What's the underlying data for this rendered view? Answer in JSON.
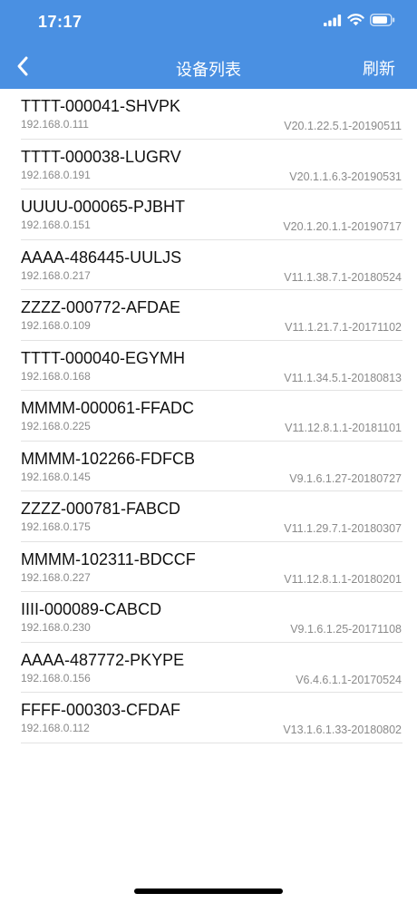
{
  "status_bar": {
    "time": "17:17",
    "icons": [
      "cellular-signal-icon",
      "wifi-icon",
      "battery-icon"
    ]
  },
  "nav": {
    "back_icon": "chevron-left-icon",
    "title": "设备列表",
    "refresh_label": "刷新"
  },
  "colors": {
    "header": "#4a90e2",
    "primary_text": "#111111",
    "secondary_text": "#8a8a8a",
    "divider": "#e2e2e2"
  },
  "devices": [
    {
      "name": "TTTT-000041-SHVPK",
      "ip": "192.168.0.111",
      "version": "V20.1.22.5.1-20190511"
    },
    {
      "name": "TTTT-000038-LUGRV",
      "ip": "192.168.0.191",
      "version": "V20.1.1.6.3-20190531"
    },
    {
      "name": "UUUU-000065-PJBHT",
      "ip": "192.168.0.151",
      "version": "V20.1.20.1.1-20190717"
    },
    {
      "name": "AAAA-486445-UULJS",
      "ip": "192.168.0.217",
      "version": "V11.1.38.7.1-20180524"
    },
    {
      "name": "ZZZZ-000772-AFDAE",
      "ip": "192.168.0.109",
      "version": "V11.1.21.7.1-20171102"
    },
    {
      "name": "TTTT-000040-EGYMH",
      "ip": "192.168.0.168",
      "version": "V11.1.34.5.1-20180813"
    },
    {
      "name": "MMMM-000061-FFADC",
      "ip": "192.168.0.225",
      "version": "V11.12.8.1.1-20181101"
    },
    {
      "name": "MMMM-102266-FDFCB",
      "ip": "192.168.0.145",
      "version": "V9.1.6.1.27-20180727"
    },
    {
      "name": "ZZZZ-000781-FABCD",
      "ip": "192.168.0.175",
      "version": "V11.1.29.7.1-20180307"
    },
    {
      "name": "MMMM-102311-BDCCF",
      "ip": "192.168.0.227",
      "version": "V11.12.8.1.1-20180201"
    },
    {
      "name": "IIII-000089-CABCD",
      "ip": "192.168.0.230",
      "version": "V9.1.6.1.25-20171108"
    },
    {
      "name": "AAAA-487772-PKYPE",
      "ip": "192.168.0.156",
      "version": "V6.4.6.1.1-20170524"
    },
    {
      "name": "FFFF-000303-CFDAF",
      "ip": "192.168.0.112",
      "version": "V13.1.6.1.33-20180802"
    }
  ]
}
